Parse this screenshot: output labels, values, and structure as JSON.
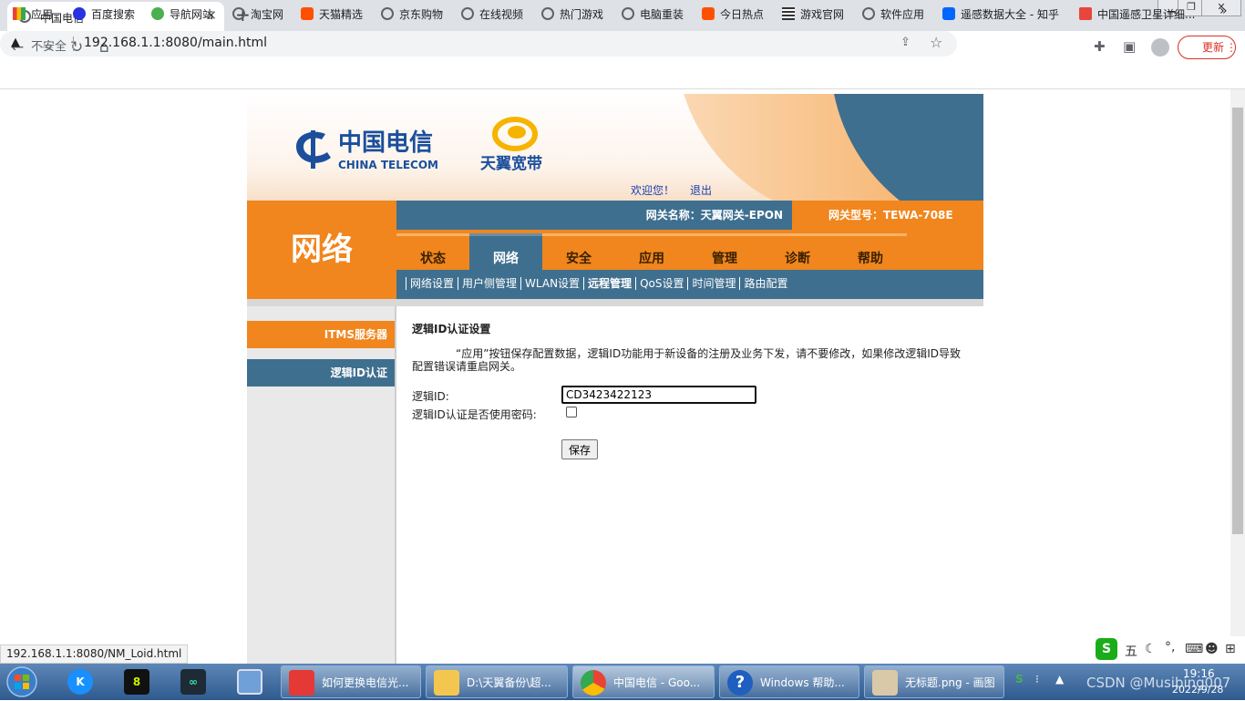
{
  "browser": {
    "tab_title": "中国电信",
    "security_label": "不安全",
    "url": "192.168.1.1:8080/main.html",
    "update_label": "更新",
    "status_url": "192.168.1.1:8080/NM_Loid.html"
  },
  "bookmarks": [
    "应用",
    "百度搜索",
    "导航网站",
    "淘宝网",
    "天猫精选",
    "京东购物",
    "在线视频",
    "热门游戏",
    "电脑重装",
    "今日热点",
    "游戏官网",
    "软件应用",
    "遥感数据大全 - 知乎",
    "中国遥感卫星详细..."
  ],
  "router": {
    "logo_text": "CHINA TELECOM",
    "logo_cn": "中国电信",
    "brand": "天翼宽带",
    "welcome": "欢迎您！",
    "logout": "退出",
    "section_title": "网络",
    "gateway_name": "网关名称：天翼网关-EPON",
    "gateway_model": "网关型号：TEWA-708E",
    "nav_tabs": [
      "状态",
      "网络",
      "安全",
      "应用",
      "管理",
      "诊断",
      "帮助"
    ],
    "active_tab": "网络",
    "sub_nav": [
      "网络设置",
      "用户侧管理",
      "WLAN设置",
      "远程管理",
      "QoS设置",
      "时间管理",
      "路由配置"
    ],
    "active_sub": "远程管理",
    "left_menu": [
      "ITMS服务器",
      "逻辑ID认证"
    ],
    "content_title": "逻辑ID认证设置",
    "content_desc": "“应用”按钮保存配置数据，逻辑ID功能用于新设备的注册及业务下发，请不要修改，如果修改逻辑ID导致配置错误请重启网关。",
    "loid_label": "逻辑ID:",
    "loid_value": "CD3423422123",
    "pwd_label": "逻辑ID认证是否使用密码:",
    "save_label": "保存"
  },
  "taskbar": {
    "tasks": [
      "如何更换电信光...",
      "D:\\天翼备份\\超...",
      "中国电信 - Goo...",
      "Windows 帮助...",
      "无标题.png - 画图"
    ],
    "time": "19:16",
    "date": "2022/9/28",
    "watermark": "CSDN @Musibing007"
  },
  "ime": {
    "label": "五"
  },
  "colors": {
    "orange": "#f0861d",
    "steel_blue": "#3f6f8f",
    "link_blue": "#1a3fb0"
  }
}
